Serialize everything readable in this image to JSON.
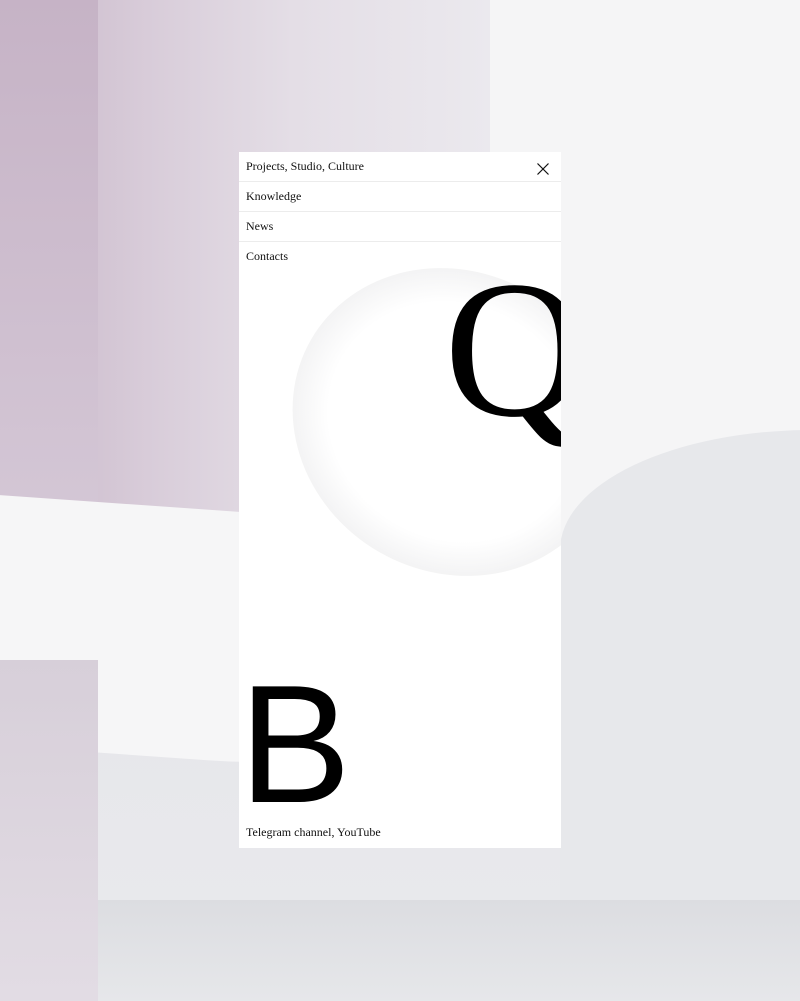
{
  "menu": {
    "items": [
      {
        "label": "Projects, Studio, Culture"
      },
      {
        "label": "Knowledge"
      },
      {
        "label": "News"
      },
      {
        "label": "Contacts"
      }
    ],
    "close_icon": "close-icon"
  },
  "decor": {
    "glyph_top": "Q",
    "glyph_bottom": "B"
  },
  "footer": {
    "link_telegram": "Telegram channel",
    "separator": ", ",
    "link_youtube": "YouTube"
  },
  "colors": {
    "panel": "#ffffff",
    "text": "#111111"
  }
}
